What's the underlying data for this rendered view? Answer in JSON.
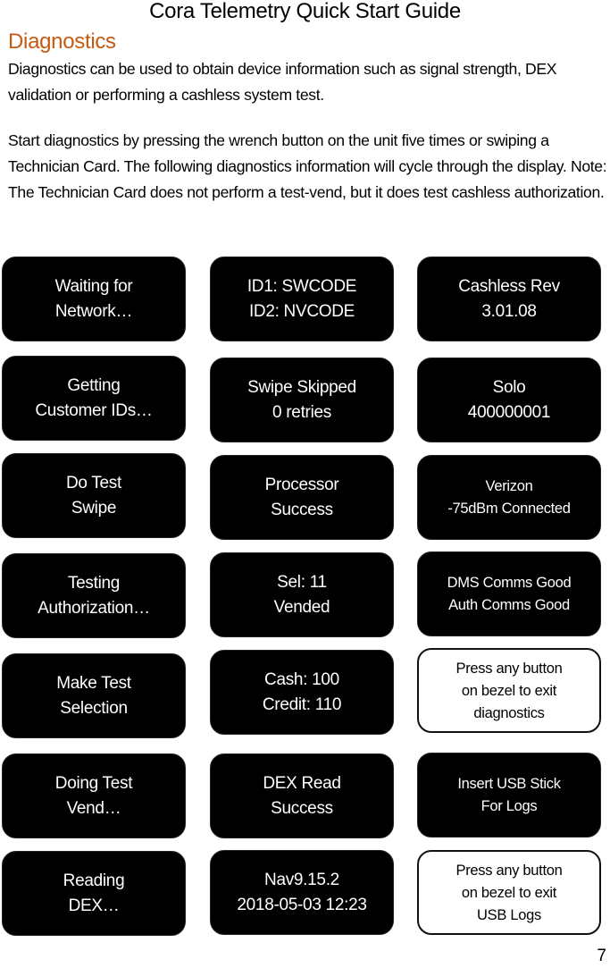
{
  "header": {
    "title": "Cora Telemetry Quick Start Guide"
  },
  "section": {
    "heading": "Diagnostics",
    "heading_color": "#c55a11",
    "paragraphs": [
      "Diagnostics can be used to obtain device information such as signal strength, DEX validation or performing a cashless system test.",
      "Start diagnostics by pressing the wrench button on the unit five times or swiping a Technician Card.  The following diagnostics information will cycle through the display. Note: The Technician Card does not perform a test-vend, but it does test cashless authorization."
    ]
  },
  "screens": {
    "column1": [
      {
        "line1": "Waiting for",
        "line2": "Network…"
      },
      {
        "line1": "Getting",
        "line2": "Customer IDs…"
      },
      {
        "line1": "Do Test",
        "line2": "Swipe"
      },
      {
        "line1": "Testing",
        "line2": "Authorization…"
      },
      {
        "line1": "Make Test",
        "line2": "Selection"
      },
      {
        "line1": "Doing Test",
        "line2": "Vend…"
      },
      {
        "line1": "Reading",
        "line2": "DEX…"
      }
    ],
    "column2": [
      {
        "line1": "ID1: SWCODE",
        "line2": "ID2: NVCODE"
      },
      {
        "line1": "Swipe Skipped",
        "line2": "0 retries"
      },
      {
        "line1": "Processor",
        "line2": "Success"
      },
      {
        "line1": "Sel: 11",
        "line2": "Vended"
      },
      {
        "line1": "Cash: 100",
        "line2": "Credit: 110"
      },
      {
        "line1": "DEX Read",
        "line2": "Success"
      },
      {
        "line1": "Nav9.15.2",
        "line2": "2018-05-03 12:23"
      }
    ],
    "column3": [
      {
        "line1": "Cashless Rev",
        "line2": "3.01.08"
      },
      {
        "line1": "Solo",
        "line2": "400000001"
      },
      {
        "line1": "Verizon",
        "line2": "-75dBm Connected"
      },
      {
        "line1": "DMS Comms Good",
        "line2": "Auth Comms Good"
      },
      {
        "line1": "Press any button",
        "line2": "on bezel to exit",
        "line3": "diagnostics"
      },
      {
        "line1": "Insert USB Stick",
        "line2": "For Logs"
      },
      {
        "line1": "Press any button",
        "line2": "on bezel to exit",
        "line3": "USB Logs"
      }
    ]
  },
  "footer": {
    "page_number": "7"
  }
}
